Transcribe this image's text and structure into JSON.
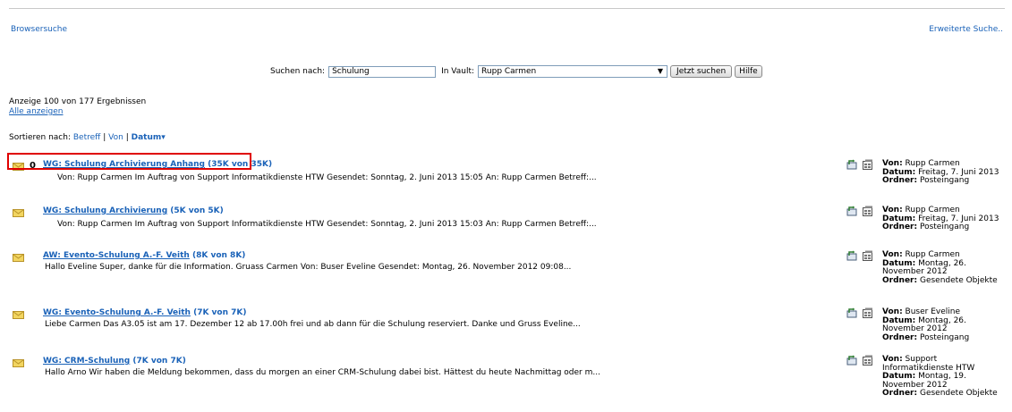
{
  "top_links": {
    "browse": "Browsersuche",
    "advanced": "Erweiterte Suche.."
  },
  "search": {
    "label": "Suchen nach:",
    "value": "Schulung",
    "vault_label": "In Vault:",
    "vault_value": "Rupp Carmen",
    "search_button": "Jetzt suchen",
    "help_button": "Hilfe"
  },
  "summary": {
    "count": "Anzeige 100 von 177 Ergebnissen",
    "show_all": "Alle anzeigen"
  },
  "sort": {
    "label": "Sortieren nach:",
    "subject": "Betreff",
    "sep1": "|",
    "from": "Von",
    "sep2": "|",
    "date": "Datum",
    "date_arrow": "▾"
  },
  "results": [
    {
      "subject": "WG: Schulung Archivierung Anhang",
      "size": "(35K von 35K)",
      "has_attachment": true,
      "snippet": "Von: Rupp Carmen Im Auftrag von Support Informatikdienste HTW Gesendet: Sonntag, 2. Juni 2013 15:05 An: Rupp Carmen Betreff:...",
      "von_label": "Von:",
      "von": "Rupp Carmen",
      "datum_label": "Datum:",
      "datum": "Freitag, 7. Juni 2013",
      "ordner_label": "Ordner:",
      "ordner": "Posteingang"
    },
    {
      "subject": "WG: Schulung Archivierung",
      "size": "(5K von 5K)",
      "has_attachment": false,
      "snippet": "Von: Rupp Carmen Im Auftrag von Support Informatikdienste HTW Gesendet: Sonntag, 2. Juni 2013 15:03 An: Rupp Carmen Betreff:...",
      "von_label": "Von:",
      "von": "Rupp Carmen",
      "datum_label": "Datum:",
      "datum": "Freitag, 7. Juni 2013",
      "ordner_label": "Ordner:",
      "ordner": "Posteingang"
    },
    {
      "subject": "AW: Evento-Schulung A.-F. Veith",
      "size": "(8K von 8K)",
      "has_attachment": false,
      "snippet": "Hallo Eveline   Super, danke für die Information.   Gruass Carmen   Von: Buser Eveline Gesendet: Montag, 26. November 2012 09:08...",
      "von_label": "Von:",
      "von": "Rupp Carmen",
      "datum_label": "Datum:",
      "datum": "Montag, 26. November 2012",
      "ordner_label": "Ordner:",
      "ordner": "Gesendete Objekte"
    },
    {
      "subject": "WG: Evento-Schulung A.-F. Veith",
      "size": "(7K von 7K)",
      "has_attachment": false,
      "snippet": "Liebe Carmen Das A3.05 ist am 17. Dezember 12 ab 17.00h frei und ab dann für die Schulung reserviert.   Danke und Gruss Eveline...",
      "von_label": "Von:",
      "von": "Buser Eveline",
      "datum_label": "Datum:",
      "datum": "Montag, 26. November 2012",
      "ordner_label": "Ordner:",
      "ordner": "Posteingang"
    },
    {
      "subject": "WG: CRM-Schulung",
      "size": "(7K von 7K)",
      "has_attachment": false,
      "snippet": "Hallo Arno   Wir haben die Meldung bekommen, dass du morgen an einer CRM-Schulung dabei bist. Hättest du heute Nachmittag oder m...",
      "von_label": "Von:",
      "von": "Support Informatikdienste HTW",
      "datum_label": "Datum:",
      "datum": "Montag, 19. November 2012",
      "ordner_label": "Ordner:",
      "ordner": "Gesendete Objekte"
    }
  ],
  "colors": {
    "link": "#1a62b8",
    "highlight": "#e00000",
    "envelope": "#e8c64a"
  }
}
